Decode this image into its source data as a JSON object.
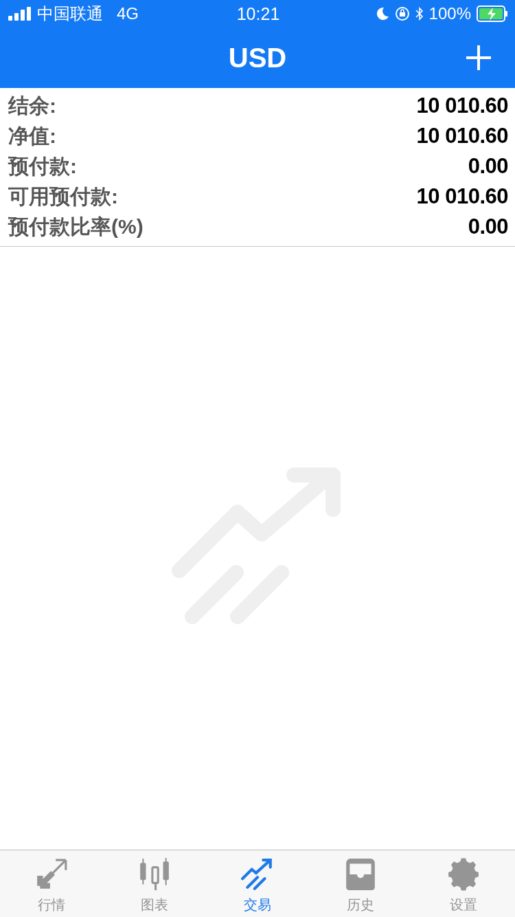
{
  "status_bar": {
    "carrier": "中国联通",
    "network": "4G",
    "time": "10:21",
    "battery": "100%"
  },
  "nav_bar": {
    "title": "USD"
  },
  "account": [
    {
      "label": "结余:",
      "value": "10 010.60"
    },
    {
      "label": "净值:",
      "value": "10 010.60"
    },
    {
      "label": "预付款:",
      "value": "0.00"
    },
    {
      "label": "可用预付款:",
      "value": "10 010.60"
    },
    {
      "label": "预付款比率(%)",
      "value": "0.00"
    }
  ],
  "tabs": [
    {
      "kind": "quotes",
      "label": "行情",
      "selected": false
    },
    {
      "kind": "chart",
      "label": "图表",
      "selected": false
    },
    {
      "kind": "trade",
      "label": "交易",
      "selected": true
    },
    {
      "kind": "history",
      "label": "历史",
      "selected": false
    },
    {
      "kind": "settings",
      "label": "设置",
      "selected": false
    }
  ]
}
